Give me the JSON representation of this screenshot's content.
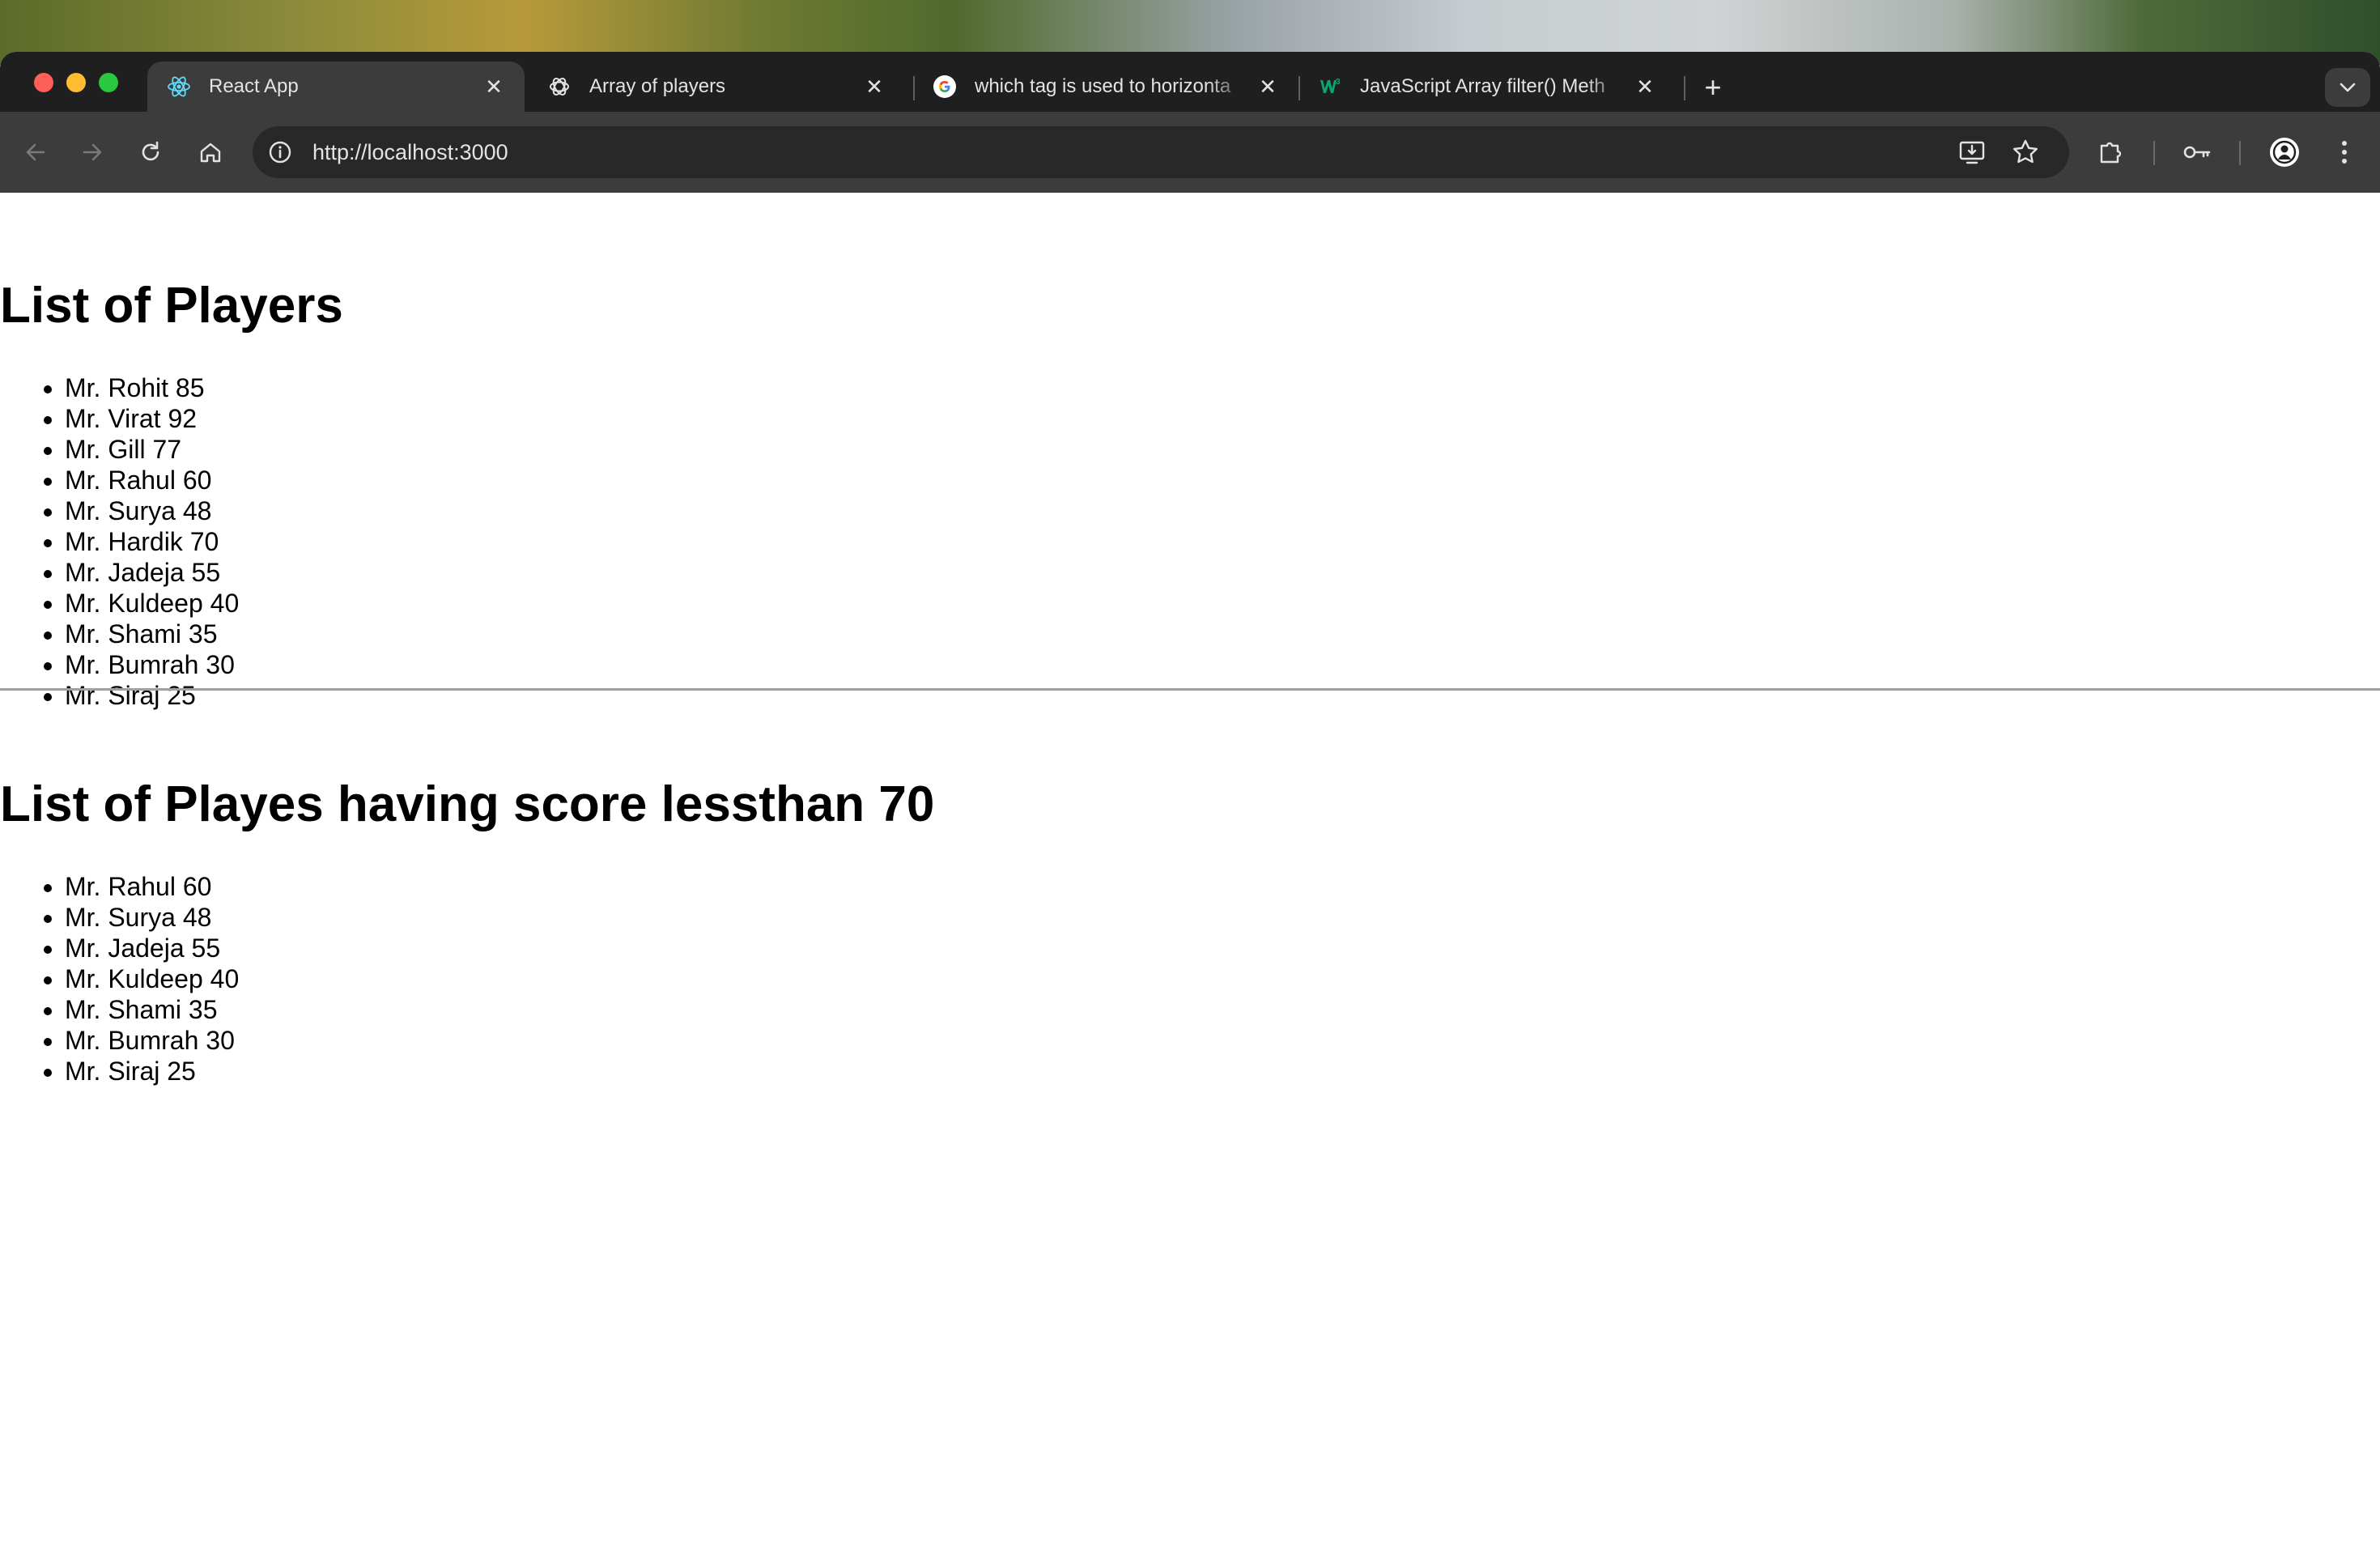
{
  "browser": {
    "tabs": [
      {
        "title": "React App",
        "favicon": "react-icon",
        "active": true
      },
      {
        "title": "Array of players",
        "favicon": "chatgpt-icon",
        "active": false
      },
      {
        "title": "which tag is used to horizonta",
        "favicon": "google-icon",
        "active": false
      },
      {
        "title": "JavaScript Array filter() Meth",
        "favicon": "w3schools-icon",
        "active": false
      }
    ],
    "url": "http://localhost:3000"
  },
  "page": {
    "heading_all": "List of Players",
    "players": [
      "Mr. Rohit 85",
      "Mr. Virat 92",
      "Mr. Gill 77",
      "Mr. Rahul 60",
      "Mr. Surya 48",
      "Mr. Hardik 70",
      "Mr. Jadeja 55",
      "Mr. Kuldeep 40",
      "Mr. Shami 35",
      "Mr. Bumrah 30",
      "Mr. Siraj 25"
    ],
    "heading_filtered": "List of Playes having score lessthan 70",
    "filtered_players": [
      "Mr. Rahul 60",
      "Mr. Surya 48",
      "Mr. Jadeja 55",
      "Mr. Kuldeep 40",
      "Mr. Shami 35",
      "Mr. Bumrah 30",
      "Mr. Siraj 25"
    ]
  }
}
